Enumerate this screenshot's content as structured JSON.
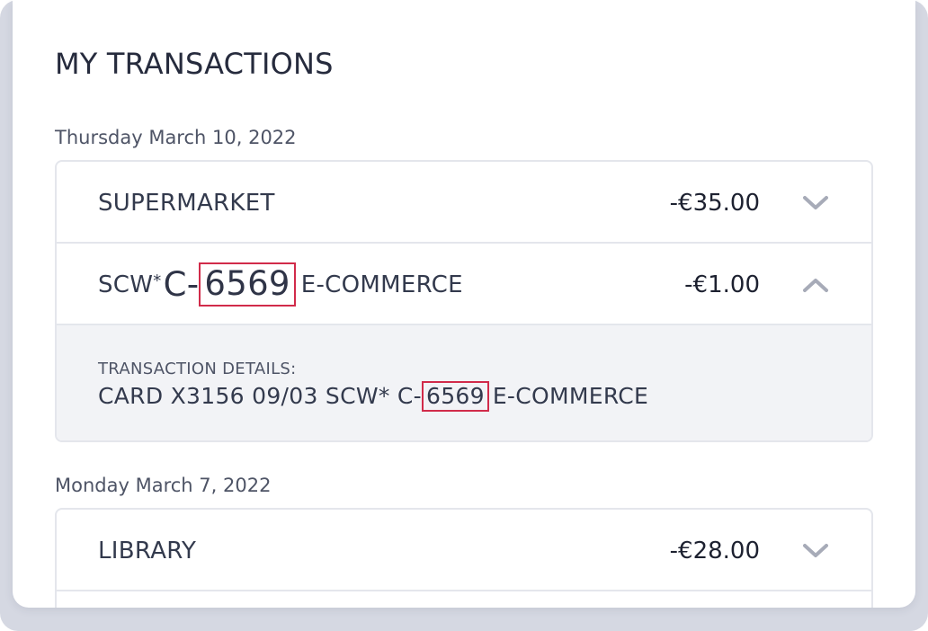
{
  "title": "MY TRANSACTIONS",
  "colors": {
    "highlight_border": "#d12b4a",
    "chevron": "#a7abb8",
    "details_bg": "#f2f3f6"
  },
  "groups": [
    {
      "date": "Thursday March 10, 2022",
      "transactions": [
        {
          "name": "SUPERMARKET",
          "amount": "-€35.00",
          "chevron": "chevron-down-icon"
        },
        {
          "name_prefix": "SCW",
          "name_star": "*",
          "name_c": "C",
          "name_dash": "-",
          "name_code": "6569",
          "name_suffix": "E-COMMERCE",
          "amount": "-€1.00",
          "chevron": "chevron-up-icon",
          "expanded": true,
          "details_label": "TRANSACTION DETAILS:",
          "details_prefix": "CARD X3156 09/03 SCW* C",
          "details_dash": "-",
          "details_code": "6569",
          "details_suffix": "E-COMMERCE"
        }
      ]
    },
    {
      "date": "Monday March 7, 2022",
      "transactions": [
        {
          "name": "LIBRARY",
          "amount": "-€28.00",
          "chevron": "chevron-down-icon"
        }
      ]
    }
  ]
}
